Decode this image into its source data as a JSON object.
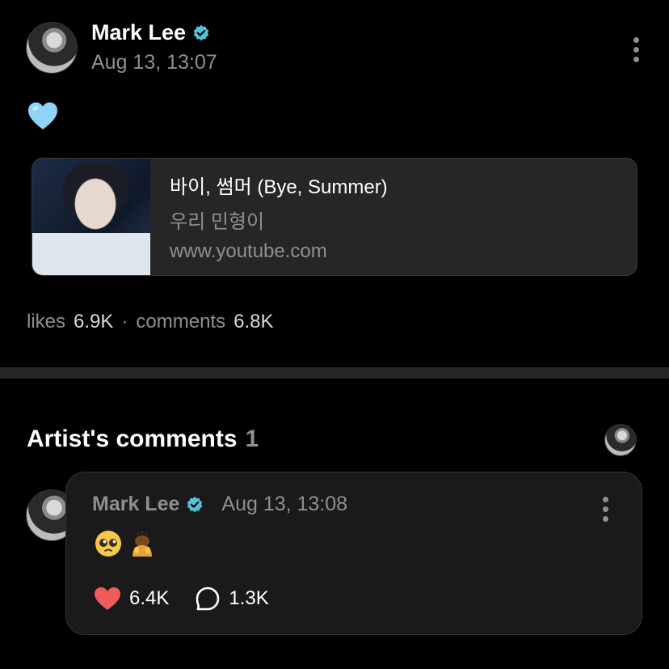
{
  "post": {
    "author": "Mark Lee",
    "time": "Aug 13, 13:07",
    "body_emoji": "light-blue-heart",
    "link": {
      "title": "바이, 썸머 (Bye, Summer)",
      "subtitle": "우리 민형이",
      "url": "www.youtube.com"
    },
    "likes_label": "likes",
    "likes": "6.9K",
    "separator": "·",
    "comments_label": "comments",
    "comments": "6.8K"
  },
  "section": {
    "title": "Artist's comments",
    "count": "1"
  },
  "comment": {
    "author": "Mark Lee",
    "time": "Aug 13, 13:08",
    "emojis": [
      "pleading-face",
      "person-bowing"
    ],
    "likes": "6.4K",
    "replies": "1.3K"
  },
  "colors": {
    "background": "#000000",
    "verified": "#4fc3d9",
    "like_heart": "#f05a5a",
    "muted_text": "#8f8f8f",
    "card": "#262626"
  }
}
